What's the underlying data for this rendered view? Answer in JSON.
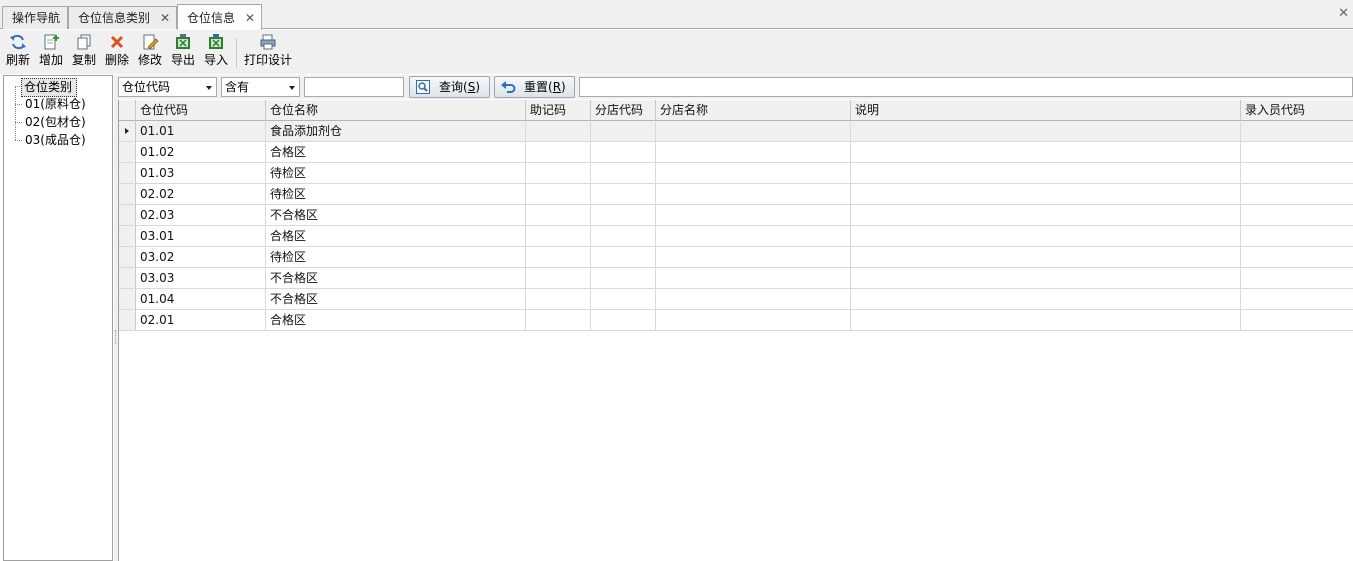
{
  "tabs": [
    {
      "label": "操作导航",
      "closable": false
    },
    {
      "label": "仓位信息类别",
      "closable": true
    },
    {
      "label": "仓位信息",
      "closable": true,
      "active": true
    }
  ],
  "close_glyph": "✕",
  "toolbar": {
    "buttons": [
      {
        "label": "刷新",
        "icon": "refresh-icon"
      },
      {
        "label": "增加",
        "icon": "add-icon"
      },
      {
        "label": "复制",
        "icon": "copy-icon"
      },
      {
        "label": "删除",
        "icon": "delete-icon"
      },
      {
        "label": "修改",
        "icon": "edit-icon"
      },
      {
        "label": "导出",
        "icon": "excel-export-icon"
      },
      {
        "label": "导入",
        "icon": "excel-import-icon"
      },
      {
        "label": "打印设计",
        "icon": "print-design-icon"
      }
    ]
  },
  "tree": {
    "root": "仓位类别",
    "items": [
      "01(原料仓)",
      "02(包材仓)",
      "03(成品仓)"
    ]
  },
  "search": {
    "field": "仓位代码",
    "operator": "含有",
    "value": "",
    "query_label": "查询(",
    "query_key": "S",
    "query_close": ")",
    "reset_label": "重置(",
    "reset_key": "R",
    "reset_close": ")"
  },
  "grid": {
    "columns": [
      "仓位代码",
      "仓位名称",
      "助记码",
      "分店代码",
      "分店名称",
      "说明",
      "录入员代码"
    ],
    "rows": [
      [
        "01.01",
        "食品添加剂仓",
        "",
        "",
        "",
        "",
        ""
      ],
      [
        "01.02",
        "合格区",
        "",
        "",
        "",
        "",
        ""
      ],
      [
        "01.03",
        "待检区",
        "",
        "",
        "",
        "",
        ""
      ],
      [
        "02.02",
        "待检区",
        "",
        "",
        "",
        "",
        ""
      ],
      [
        "02.03",
        "不合格区",
        "",
        "",
        "",
        "",
        ""
      ],
      [
        "03.01",
        "合格区",
        "",
        "",
        "",
        "",
        ""
      ],
      [
        "03.02",
        "待检区",
        "",
        "",
        "",
        "",
        ""
      ],
      [
        "03.03",
        "不合格区",
        "",
        "",
        "",
        "",
        ""
      ],
      [
        "01.04",
        "不合格区",
        "",
        "",
        "",
        "",
        ""
      ],
      [
        "02.01",
        "合格区",
        "",
        "",
        "",
        "",
        ""
      ]
    ],
    "selected_row": 0
  },
  "colors": {
    "accent_blue": "#2f6eb5",
    "excel_green": "#2e7d32",
    "delete_red": "#d9531e"
  }
}
